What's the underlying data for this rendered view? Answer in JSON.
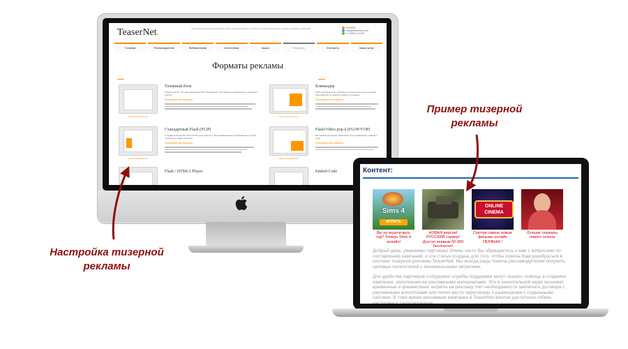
{
  "imac": {
    "site_logo": "TeaserNet",
    "header_text": "«мы гарантируем бесперебойную работу, высокую скорость загрузки и полную безопасность ваших рекламных кампаний»",
    "contacts": [
      "5199090",
      "http@teasernet.com",
      "+7 (495) 2-24-80"
    ],
    "nav": [
      "Главная",
      "Рекламодателю",
      "Вебмастерам",
      "Агентствам",
      "Акция",
      "Форматы",
      "Контакты",
      "Заказ услуг"
    ],
    "nav_active_index": 5,
    "page_title": "Форматы рекламы",
    "formats": [
      {
        "title": "Тизерный блок",
        "desc": "Тизерный блок - это настраиваемый блок объявлений, состоящий из изображения и текстовых ссылок.",
        "advantages_label": "Преимущества формата",
        "thumb_caption": "Зарегистрироваться"
      },
      {
        "title": "Кликандер",
        "desc": "Сайт рекламодателя открывается в отдельном окне при клике пользователя по любому элементу страницы.",
        "advantages_label": "Преимущества формата",
        "thumb_caption": "Зарегистрироваться"
      },
      {
        "title": "Стандартный Flash (FLIP)",
        "desc": "Стандартный формат Flash (FLIP) представляет собой анимированное изображение, которое появляется поверх контента.",
        "advantages_label": "Преимущества формата",
        "thumb_caption": "Зарегистрироваться"
      },
      {
        "title": "Flash/Video pop-ù (FLOP/VOP)",
        "desc": "Всплывающий формат Flash/Video для продвижения товаров и услуг.",
        "advantages_label": "Преимущества формата",
        "thumb_caption": "Зарегистрироваться"
      },
      {
        "title": "Flash / HTML5 Player",
        "desc": "",
        "advantages_label": "",
        "thumb_caption": ""
      },
      {
        "title": "Embed Code",
        "desc": "",
        "advantages_label": "",
        "thumb_caption": ""
      }
    ]
  },
  "laptop": {
    "content_header": "Контент:",
    "teasers": [
      {
        "caption": "Вы не играли весь год? Теперь Sims 4 онлайн!",
        "image_label": "Sims 4",
        "badge": "ИГРАТЬ"
      },
      {
        "caption": "НОВАЯ версия! РУССКИЙ сервер! Доступ первым 50.000 бесплатно!",
        "image_label": "",
        "badge": ""
      },
      {
        "caption": "Смотри самые новые фильмы онлайн ПЕРВЫМ !",
        "image_label": "ONLINE CINEMA",
        "badge": ""
      },
      {
        "caption": "Лучшие сериалы нового сезона",
        "image_label": "",
        "badge": ""
      }
    ],
    "paragraph1": "Добрый день, уважаемы партнеры! Очень часто Вы обращаетесь к нам с вопросами по составлению кампаний, и эта статья создана для того, чтобы помочь Вам разобраться в системе тизерной рекламы TeaserNet. Мы всегда рады помочь рекламодателям получить целевых посетителей с минимальными затратами.",
    "paragraph2": "Для удобства партнеров сотрудники службы поддержки могут оказать помощь в создании кампании, заполнении ее рекламными материалами. Это в значительной мере экономит временные и финансовые затраты на рекламу. Нет необходимости заключать договора с рекламными агентствами или лично вести переговоры о размещении с отдельными сайтами. В тоже время рекламная кампания в TeaserNet вполне достаточно гибкие настройки и таргетирование."
  },
  "callouts": {
    "example": "Пример тизерной рекламы",
    "setup": "Настройка тизерной рекламы"
  },
  "colors": {
    "accent_orange": "#ff8a00",
    "callout_red": "#8e0e0e",
    "teaser_red": "#d0000b",
    "content_blue": "#14315c"
  }
}
